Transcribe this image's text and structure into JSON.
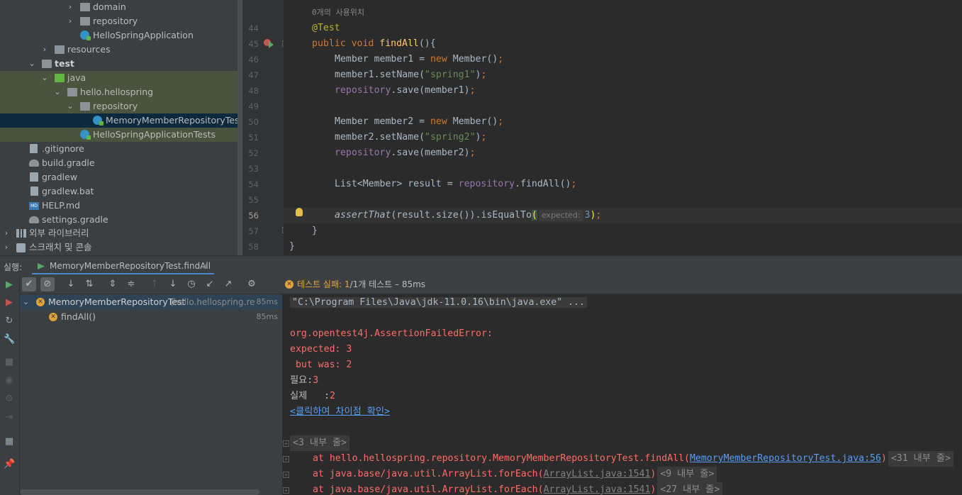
{
  "project_tree": {
    "items": [
      {
        "label": "domain"
      },
      {
        "label": "repository"
      },
      {
        "label": "HelloSpringApplication"
      },
      {
        "label": "resources"
      },
      {
        "label": "test"
      },
      {
        "label": "java"
      },
      {
        "label": "hello.hellospring"
      },
      {
        "label": "repository"
      },
      {
        "label": "MemoryMemberRepositoryTest"
      },
      {
        "label": "HelloSpringApplicationTests"
      },
      {
        "label": ".gitignore"
      },
      {
        "label": "build.gradle"
      },
      {
        "label": "gradlew"
      },
      {
        "label": "gradlew.bat"
      },
      {
        "label": "HELP.md"
      },
      {
        "label": "settings.gradle"
      },
      {
        "label": "외부 라이브러리"
      },
      {
        "label": "스크래치 및 콘솔"
      }
    ]
  },
  "editor": {
    "usages_hint": "0개의 사용위치",
    "line_numbers": [
      "44",
      "45",
      "46",
      "47",
      "48",
      "49",
      "50",
      "51",
      "52",
      "53",
      "54",
      "55",
      "56",
      "57",
      "58"
    ],
    "current_line": "56",
    "hint_label": "expected:"
  },
  "run": {
    "label": "실행:",
    "tab_title": "MemoryMemberRepositoryTest.findAll",
    "tab_close": "×",
    "status": {
      "fail_label": "테스트 실패:",
      "fail_count": "1",
      "total": "/1개 테스트",
      "time": "– 85ms"
    },
    "tests": [
      {
        "name": "MemoryMemberRepositoryTest",
        "package": "(hello.hellospring.repos",
        "time": "85ms"
      },
      {
        "name": "findAll()",
        "time": "85ms"
      }
    ]
  },
  "console": {
    "command": "\"C:\\Program Files\\Java\\jdk-11.0.16\\bin\\java.exe\" ...",
    "error_class": "org.opentest4j.AssertionFailedError:",
    "expected_line": "expected: 3",
    "but_was_line": " but was: 2",
    "required_label": "필요:",
    "required_value": "3",
    "actual_label": "실제   :",
    "actual_value": "2",
    "diff_link": "<클릭하여 차이점 확인>",
    "fold1": "<3 내부 줄>",
    "trace1_prefix": "at hello.hellospring.repository.MemoryMemberRepositoryTest.findAll(",
    "trace1_link": "MemoryMemberRepositoryTest.java:56",
    "trace1_suffix": ")",
    "trace1_fold": "<31 내부 줄>",
    "trace2_prefix": "at java.base/java.util.ArrayList.forEach(",
    "trace2_link": "ArrayList.java:1541",
    "trace2_suffix": ")",
    "trace2_fold": "<9 내부 줄>",
    "trace3_prefix": "at java.base/java.util.ArrayList.forEach(",
    "trace3_link": "ArrayList.java:1541",
    "trace3_suffix": ")",
    "trace3_fold": "<27 내부 줄>"
  }
}
